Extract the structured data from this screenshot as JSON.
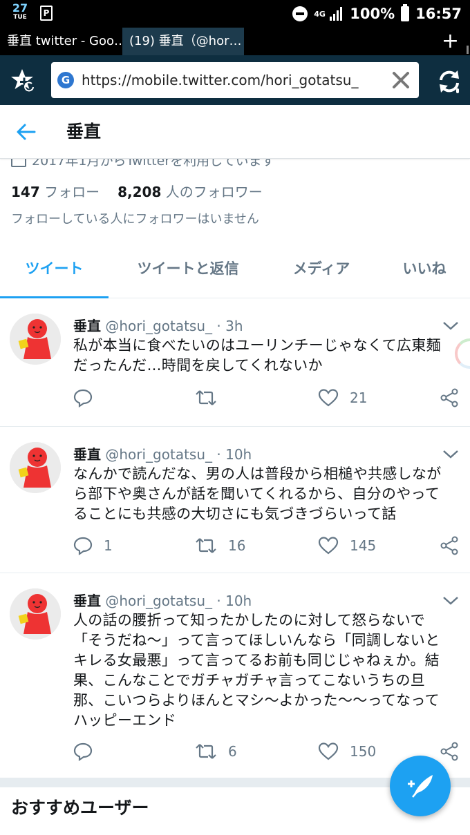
{
  "status_bar": {
    "date_day": "27",
    "date_weekday": "TUE",
    "notification_letter": "P",
    "network": "4G",
    "battery": "100%",
    "time": "16:57"
  },
  "browser": {
    "tabs": [
      {
        "label": "垂直 twitter - Goo…"
      },
      {
        "label": "(19) 垂直（@hor…"
      }
    ],
    "new_tab": "+",
    "url": "https://mobile.twitter.com/hori_gotatsu_",
    "search_engine_letter": "G"
  },
  "header": {
    "title": "垂直"
  },
  "profile": {
    "joined": "2017年1月からTwitterを利用しています",
    "following_count": "147",
    "following_label": "フォロー",
    "followers_count": "8,208",
    "followers_label": "人のフォロワー",
    "mutual_note": "フォローしている人にフォロワーはいません"
  },
  "profile_tabs": [
    {
      "label": "ツイート",
      "active": true
    },
    {
      "label": "ツイートと返信",
      "active": false
    },
    {
      "label": "メディア",
      "active": false
    },
    {
      "label": "いいね",
      "active": false
    }
  ],
  "tweets": [
    {
      "name": "垂直",
      "handle": "@hori_gotatsu_",
      "dot": "·",
      "time": "3h",
      "lines": [
        "私が本当に食べたいのはユーリンチーじゃなくて広東麺",
        "だったんだ…時間を戻してくれないか"
      ],
      "replies": "",
      "retweets": "",
      "likes": "21"
    },
    {
      "name": "垂直",
      "handle": "@hori_gotatsu_",
      "dot": "·",
      "time": "10h",
      "lines": [
        "なんかで読んだな、男の人は普段から相槌や共感しなが",
        "ら部下や奥さんが話を聞いてくれるから、自分のやって",
        "ることにも共感の大切さにも気づきづらいって話"
      ],
      "replies": "1",
      "retweets": "16",
      "likes": "145"
    },
    {
      "name": "垂直",
      "handle": "@hori_gotatsu_",
      "dot": "·",
      "time": "10h",
      "lines": [
        "人の話の腰折って知ったかしたのに対して怒らないで",
        "「そうだね〜」って言ってほしいんなら「同調しないと",
        "キレる女最悪」って言ってるお前も同じじゃねぇか。結",
        "果、こんなことでガチャガチャ言ってこないうちの旦",
        "那、こいつらよりほんとマシ〜よかった〜〜ってなって",
        "ハッピーエンド"
      ],
      "replies": "",
      "retweets": "6",
      "likes": "150"
    }
  ],
  "recommend": {
    "title": "おすすめユーザー"
  },
  "colors": {
    "accent": "#1da1f2",
    "muted": "#657786",
    "text": "#14171a",
    "url_bar_bg": "#0e2e40",
    "active_tab_bg": "#1d3b4d"
  }
}
